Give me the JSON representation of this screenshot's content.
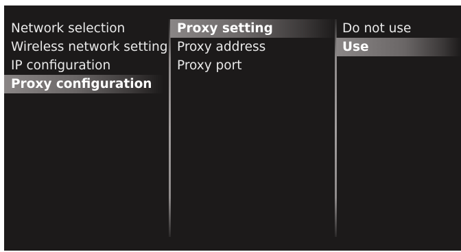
{
  "menu": {
    "network": [
      {
        "label": "Network selection"
      },
      {
        "label": "Wireless network setting"
      },
      {
        "label": "IP configuration"
      },
      {
        "label": "Proxy configuration"
      }
    ],
    "proxy": [
      {
        "label": "Proxy setting"
      },
      {
        "label": "Proxy address"
      },
      {
        "label": "Proxy port"
      }
    ],
    "options": [
      {
        "label": "Do not use"
      },
      {
        "label": "Use"
      }
    ]
  }
}
